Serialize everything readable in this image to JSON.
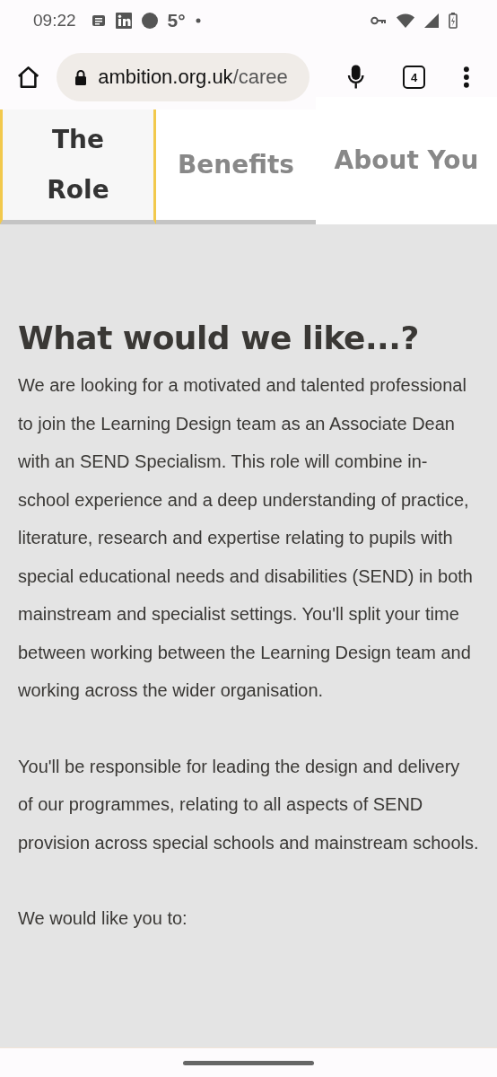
{
  "status_bar": {
    "time": "09:22",
    "temperature": "5°"
  },
  "browser": {
    "url_host": "ambition.org.uk",
    "url_path": "/caree",
    "tab_count": "4"
  },
  "tabs": [
    {
      "label": "The Role",
      "selected": true
    },
    {
      "label": "Benefits",
      "selected": false
    },
    {
      "label": "About You",
      "selected": false
    }
  ],
  "content": {
    "heading": "What would we like...?",
    "paragraphs": [
      "We are looking for a motivated and talented professional to join the Learning Design team as an Associate Dean with an SEND Specialism. This role will combine in-school experience and a deep understanding of practice, literature, research and expertise relating to pupils with special educational needs and disabilities (SEND) in both mainstream and specialist settings. You'll split your time between working between the Learning Design team and working across the wider organisation.",
      "You'll be responsible for leading the design and delivery of our programmes, relating to all aspects of SEND provision across special schools and mainstream schools.",
      "We would like you to:"
    ]
  }
}
